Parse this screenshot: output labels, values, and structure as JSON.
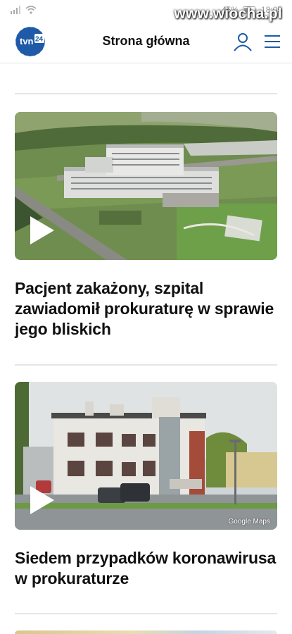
{
  "statusbar": {
    "battery": "45%",
    "time": "18:05"
  },
  "watermark": "www.wiocha.pl",
  "header": {
    "logo_text": "tvn24",
    "title": "Strona główna",
    "icons": [
      "tvn24-logo",
      "user-icon",
      "menu-icon"
    ]
  },
  "articles": [
    {
      "headline": "Pacjent zakażony, szpital zawiadomił prokuraturę w sprawie jego bliskich",
      "media": "video"
    },
    {
      "headline": "Siedem przypadków koronawirusa w prokuraturze",
      "media": "video",
      "image_credit": "Google Maps"
    }
  ],
  "colors": {
    "brand": "#1e5aa8",
    "text": "#111111",
    "divider": "#e5e5e5"
  }
}
